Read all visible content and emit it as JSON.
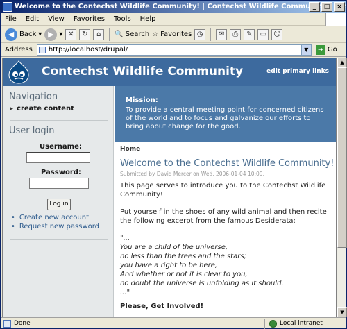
{
  "window": {
    "title": "Welcome to the Contechst Wildlife Community! | Contechst Wildlife Community - Microsoft Internet Ex...",
    "minimize": "_",
    "maximize": "□",
    "close": "×"
  },
  "menu": [
    "File",
    "Edit",
    "View",
    "Favorites",
    "Tools",
    "Help"
  ],
  "toolbar": {
    "back": "Back",
    "search": "Search",
    "favorites": "Favorites"
  },
  "address": {
    "label": "Address",
    "url": "http://localhost/drupal/",
    "go": "Go"
  },
  "status": {
    "left": "Done",
    "right": "Local intranet"
  },
  "site": {
    "name": "Contechst Wildlife Community",
    "primary_links": "edit primary links"
  },
  "sidebar": {
    "nav_title": "Navigation",
    "nav_items": [
      "create content"
    ],
    "login_title": "User login",
    "username_label": "Username:",
    "password_label": "Password:",
    "login_button": "Log in",
    "links": [
      "Create new account",
      "Request new password"
    ]
  },
  "mission": {
    "title": "Mission:",
    "text": "To provide a central meeting point for concerned citizens of the world and to focus and galvanize our efforts to bring about change for the good."
  },
  "content": {
    "breadcrumb": "Home",
    "title": "Welcome to the Contechst Wildlife Community!",
    "submitted": "Submitted by David Mercer on Wed, 2006-01-04 10:09.",
    "intro": "This page serves to introduce you to the Contechst Wildlife Community!",
    "lead": "Put yourself in the shoes of any wild animal and then recite the following excerpt from the famous Desiderata:",
    "quote_lines": [
      "\"...",
      "You are a child of the universe,",
      "no less than the trees and the stars;",
      "you have a right to be here,",
      "And whether or not it is clear to you,",
      "no doubt the universe is unfolding as it should.",
      "...\""
    ],
    "subhead": "Please, Get Involved!"
  }
}
